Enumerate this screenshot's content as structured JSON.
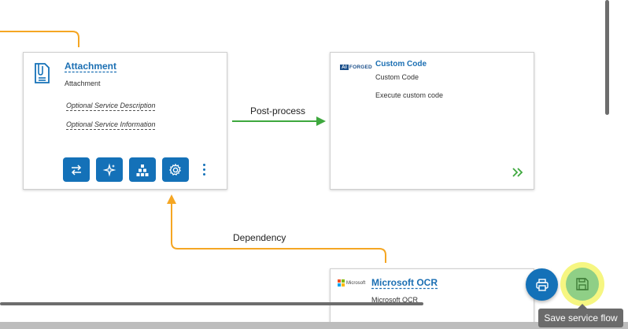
{
  "nodes": {
    "attachment": {
      "title": "Attachment",
      "subtitle": "Attachment",
      "description_link": "Optional Service Description",
      "information_link": "Optional Service Information",
      "icon": "document-attachment-icon",
      "toolbar": [
        {
          "name": "swap-icon"
        },
        {
          "name": "sparkle-icon"
        },
        {
          "name": "hierarchy-icon"
        },
        {
          "name": "gear-icon"
        }
      ]
    },
    "custom_code": {
      "title": "Custom Code",
      "subtitle": "Custom Code",
      "description": "Execute custom code",
      "logo_text_box": "AI",
      "logo_text": "FORGED",
      "icon": "double-chevron-right-icon"
    },
    "microsoft_ocr": {
      "title": "Microsoft OCR",
      "subtitle": "Microsoft OCR",
      "logo_text": "Microsoft"
    }
  },
  "edges": {
    "post_process_label": "Post-process",
    "dependency_label": "Dependency"
  },
  "colors": {
    "primary_blue": "#1471b8",
    "edge_green": "#3ea83e",
    "edge_orange": "#f5a623",
    "save_green": "#8fcf86",
    "highlight_yellow": "#f6f67a"
  },
  "actions": {
    "save_tooltip": "Save service flow",
    "print_icon": "print-icon",
    "save_icon": "floppy-disk-icon"
  }
}
